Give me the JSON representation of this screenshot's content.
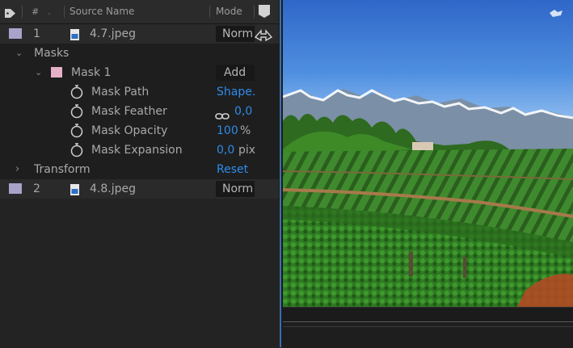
{
  "header": {
    "hash": "#",
    "source_name": "Source Name",
    "mode": "Mode"
  },
  "layers": [
    {
      "index": "1",
      "name": "4.7.jpeg",
      "mode": "Norm"
    },
    {
      "index": "2",
      "name": "4.8.jpeg",
      "mode": "Norm"
    }
  ],
  "masks": {
    "group_label": "Masks",
    "mask_name": "Mask 1",
    "mask_mode": "Add",
    "properties": [
      {
        "label": "Mask Path",
        "value": "Shape.",
        "unit": ""
      },
      {
        "label": "Mask Feather",
        "value": "0,0",
        "unit": ""
      },
      {
        "label": "Mask Opacity",
        "value": "100",
        "unit": "%"
      },
      {
        "label": "Mask Expansion",
        "value": "0,0",
        "unit": "pix"
      }
    ]
  },
  "transform": {
    "label": "Transform",
    "reset_label": "Reset"
  },
  "colors": {
    "label_lavender": "#a9a2c9",
    "label_pink": "#e6b0c6",
    "value_blue": "#2d8ceb",
    "viewer_border": "#3c6fae"
  }
}
